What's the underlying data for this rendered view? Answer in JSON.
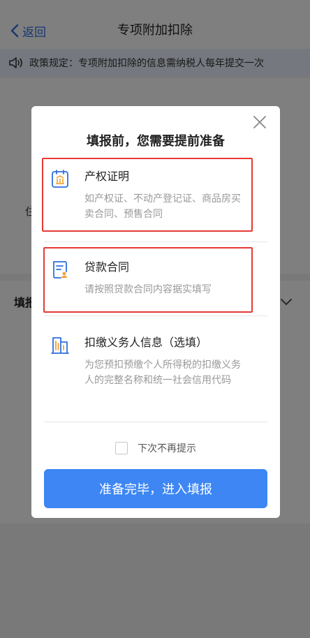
{
  "nav": {
    "back_label": "返回",
    "title": "专项附加扣除"
  },
  "notice": {
    "text": "政策规定：专项附加扣除的信息需纳税人每年提交一次"
  },
  "background": {
    "fragment_left": "住",
    "fragment_row": "填报"
  },
  "modal": {
    "title": "填报前，您需要提前准备",
    "items": [
      {
        "icon": "building-certificate-icon",
        "name": "产权证明",
        "desc": "如产权证、不动产登记证、商品房买卖合同、预售合同"
      },
      {
        "icon": "loan-contract-icon",
        "name": "贷款合同",
        "desc": "请按照贷款合同内容据实填写"
      },
      {
        "icon": "office-building-icon",
        "name": "扣缴义务人信息（选填）",
        "desc": "为您预扣预缴个人所得税的扣缴义务人的完整名称和统一社会信用代码"
      }
    ],
    "dont_show_label": "下次不再提示",
    "confirm_label": "准备完毕，进入填报"
  },
  "colors": {
    "primary": "#3d86f4",
    "highlight": "#e53935",
    "icon": "#2f6fe0"
  }
}
